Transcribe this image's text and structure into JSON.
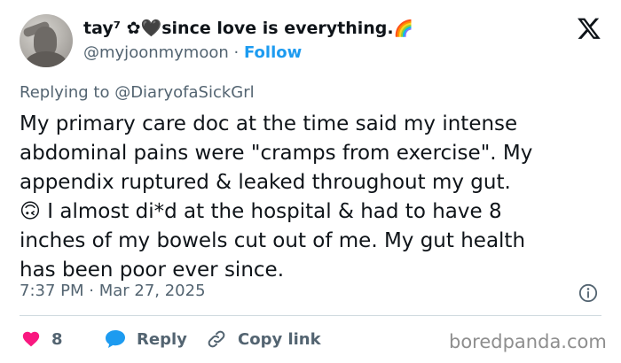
{
  "header": {
    "display_name": "tay⁷ ✿",
    "display_name_suffix": "since love is everything.",
    "heart_emoji": "🖤",
    "rainbow_emoji": "🌈",
    "handle": "@myjoonmymoon",
    "separator": "·",
    "follow_label": "Follow"
  },
  "reply_to": "Replying to @DiaryofaSickGrl",
  "tweet": {
    "text": "My primary care doc at the time said my intense\nabdominal pains were \"cramps from exercise\". My\nappendix ruptured & leaked throughout my gut.\n🙃 I almost di*d at the hospital & had to have 8\ninches of my bowels cut out of me. My gut health\nhas been poor ever since."
  },
  "timestamp": "7:37 PM · Mar 27, 2025",
  "actions": {
    "like_count": "8",
    "reply_label": "Reply",
    "copy_link_label": "Copy link"
  },
  "watermark": "boredpanda.com",
  "colors": {
    "accent": "#1d9bf0",
    "like": "#f91880",
    "muted": "#536471",
    "text": "#0f1419"
  },
  "icons": [
    "x-logo-icon",
    "info-icon",
    "heart-icon",
    "reply-bubble-icon",
    "link-icon"
  ]
}
